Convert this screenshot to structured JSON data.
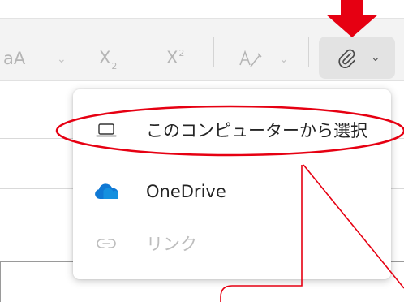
{
  "toolbar": {
    "font_case_label": "aA",
    "subscript_base": "X",
    "subscript_mark": "2",
    "superscript_base": "X",
    "superscript_mark": "2",
    "attach_chevron": "⌄"
  },
  "menu": {
    "items": [
      {
        "label": "このコンピューターから選択",
        "icon": "laptop-icon",
        "enabled": true
      },
      {
        "label": "OneDrive",
        "icon": "onedrive-cloud-icon",
        "enabled": true
      },
      {
        "label": "リンク",
        "icon": "link-icon",
        "enabled": false
      }
    ]
  },
  "colors": {
    "annotation_red": "#e60012",
    "onedrive_blue": "#0f78d4",
    "toolbar_bg": "#f3f3f3"
  }
}
